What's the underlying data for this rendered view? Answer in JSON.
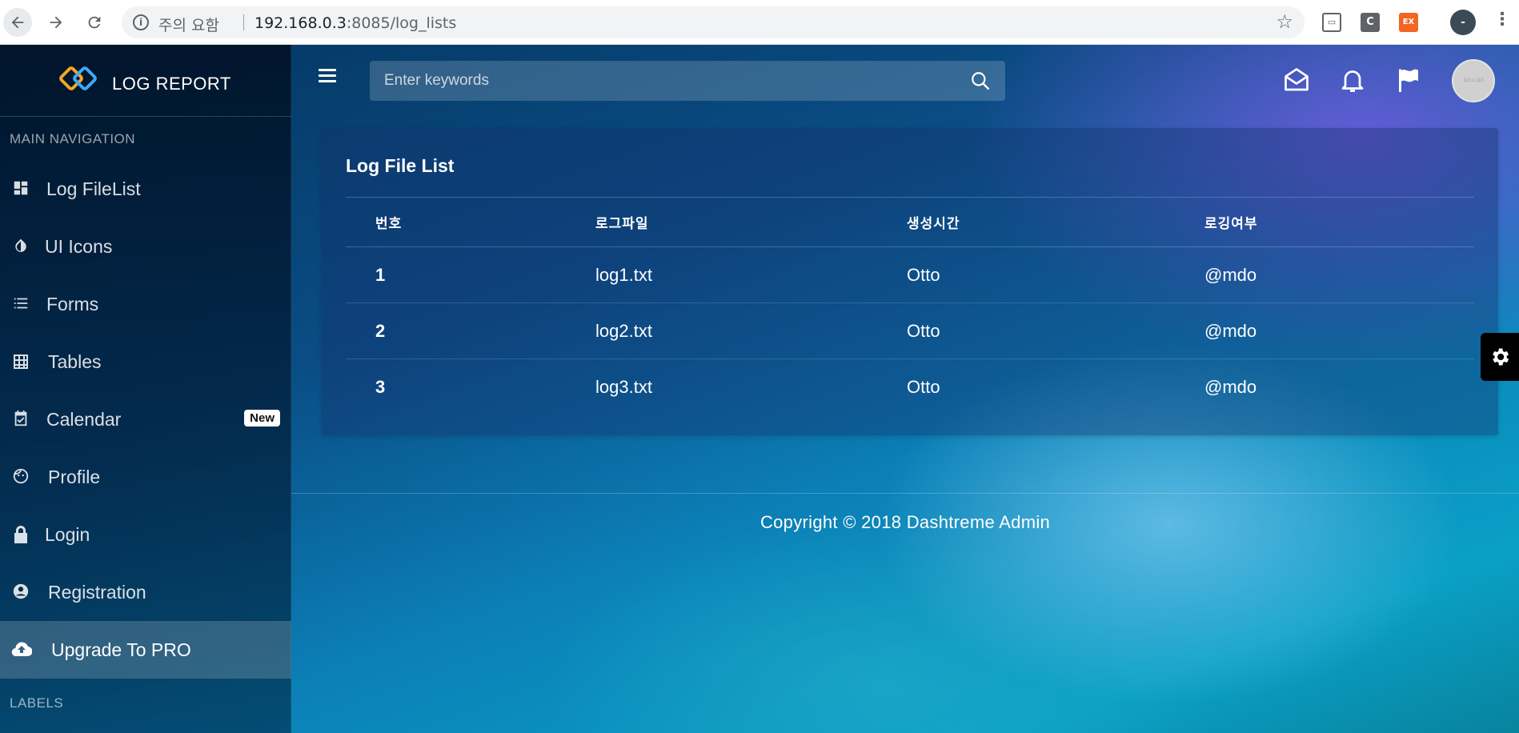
{
  "browser": {
    "security_warning": "주의 요함",
    "url_host": "192.168.0.3",
    "url_rest": ":8085/log_lists",
    "extensions": [
      "cast-icon",
      "C",
      "EX"
    ],
    "profile_initial": "-"
  },
  "brand": {
    "name": "LOG REPORT"
  },
  "sidebar": {
    "main_label": "MAIN NAVIGATION",
    "items": [
      {
        "label": "Log FileList",
        "icon": "dashboard-icon"
      },
      {
        "label": "UI Icons",
        "icon": "contrast-icon"
      },
      {
        "label": "Forms",
        "icon": "list-icon"
      },
      {
        "label": "Tables",
        "icon": "grid-icon"
      },
      {
        "label": "Calendar",
        "icon": "calendar-check-icon",
        "badge": "New"
      },
      {
        "label": "Profile",
        "icon": "face-icon"
      },
      {
        "label": "Login",
        "icon": "lock-icon"
      },
      {
        "label": "Registration",
        "icon": "account-circle-icon"
      },
      {
        "label": "Upgrade To PRO",
        "icon": "cloud-upload-icon",
        "active": true
      }
    ],
    "labels_label": "LABELS"
  },
  "topbar": {
    "search_placeholder": "Enter keywords",
    "avatar_text": "110 x 110"
  },
  "card": {
    "title": "Log File List",
    "columns": [
      "번호",
      "로그파일",
      "생성시간",
      "로깅여부"
    ],
    "rows": [
      [
        "1",
        "log1.txt",
        "Otto",
        "@mdo"
      ],
      [
        "2",
        "log2.txt",
        "Otto",
        "@mdo"
      ],
      [
        "3",
        "log3.txt",
        "Otto",
        "@mdo"
      ]
    ]
  },
  "footer": {
    "copyright": "Copyright © 2018 Dashtreme Admin"
  }
}
